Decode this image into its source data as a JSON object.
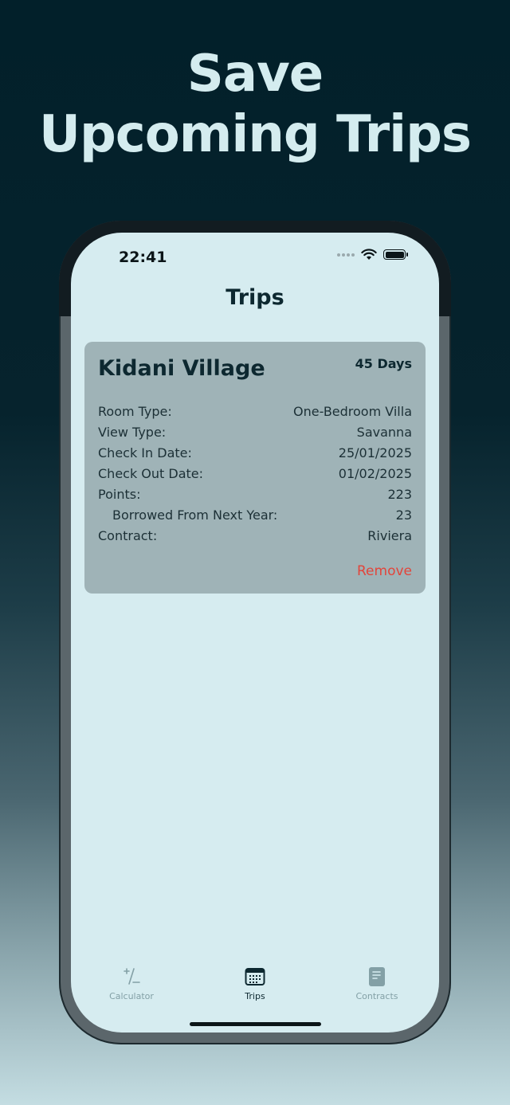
{
  "headline": {
    "line1": "Save",
    "line2": "Upcoming Trips"
  },
  "status_bar": {
    "time": "22:41"
  },
  "nav": {
    "title": "Trips"
  },
  "trip": {
    "name": "Kidani Village",
    "duration": "45 Days",
    "details": [
      {
        "label": "Room Type:",
        "value": "One-Bedroom Villa",
        "indent": false
      },
      {
        "label": "View Type:",
        "value": "Savanna",
        "indent": false
      },
      {
        "label": "Check In Date:",
        "value": "25/01/2025",
        "indent": false
      },
      {
        "label": "Check Out Date:",
        "value": "01/02/2025",
        "indent": false
      },
      {
        "label": "Points:",
        "value": "223",
        "indent": false
      },
      {
        "label": "Borrowed From Next Year:",
        "value": "23",
        "indent": true
      },
      {
        "label": "Contract:",
        "value": "Riviera",
        "indent": false
      }
    ],
    "remove_label": "Remove"
  },
  "tabs": [
    {
      "label": "Calculator",
      "icon": "plus-minus-icon",
      "active": false
    },
    {
      "label": "Trips",
      "icon": "calendar-icon",
      "active": true
    },
    {
      "label": "Contracts",
      "icon": "document-icon",
      "active": false
    }
  ],
  "colors": {
    "accent_dark": "#0d2830",
    "screen_bg": "#d6ecf0",
    "card_bg": "#9fb3b7",
    "destructive": "#e2453b",
    "tab_inactive": "#83a0a6"
  }
}
